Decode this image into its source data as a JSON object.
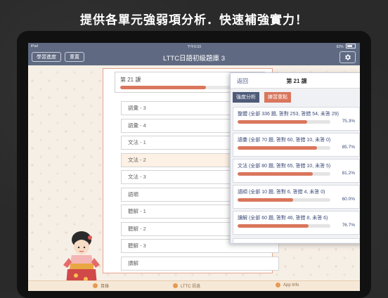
{
  "headline": "提供各單元強弱項分析．快速補強實力！",
  "statusbar": {
    "left": "iPad",
    "time": "下午6:33",
    "battery": "82%"
  },
  "nav": {
    "progress_btn": "學習進度",
    "reset_btn": "重置",
    "title": "LTTC日語初級題庫 3",
    "gear_icon": "gear-icon"
  },
  "lesson": {
    "label": "第 21 課",
    "progress": 0.75,
    "sections": [
      {
        "label": "語彙 - 3"
      },
      {
        "label": "語彙 - 4"
      },
      {
        "label": "文法 - 1"
      },
      {
        "label": "文法 - 2",
        "active": true
      },
      {
        "label": "文法 - 3"
      },
      {
        "label": "語順"
      },
      {
        "label": "聽解 - 1"
      },
      {
        "label": "聽解 - 2"
      },
      {
        "label": "聽解 - 3"
      },
      {
        "label": "讀解"
      }
    ]
  },
  "stats": {
    "back": "返回",
    "title": "第 21 課",
    "tab_strength": "強度分析",
    "tab_practice": "練習重點",
    "cards": [
      {
        "text": "整體 (全部 336 題, 答對 253, 答錯 54, 未答 29)",
        "pct": "75.3%",
        "value": 75.3
      },
      {
        "text": "語彙 (全部 70 題, 答對 60, 答錯 10, 未答 0)",
        "pct": "85.7%",
        "value": 85.7
      },
      {
        "text": "文法 (全部 80 題, 答對 65, 答錯 10, 未答 5)",
        "pct": "81.2%",
        "value": 81.2
      },
      {
        "text": "語順 (全部 10 題, 答對 6, 答錯 4, 未答 0)",
        "pct": "60.0%",
        "value": 60.0
      },
      {
        "text": "讀解 (全部 60 題, 答對 46, 答錯 8, 未答 6)",
        "pct": "76.7%",
        "value": 76.7
      }
    ]
  },
  "tabbar": {
    "items": [
      {
        "label": "目錄",
        "icon": "book-icon"
      },
      {
        "label": "LTTC 訊息",
        "icon": "info-icon"
      },
      {
        "label": "App Info",
        "icon": "app-info-icon"
      }
    ]
  },
  "colors": {
    "accent": "#d9765c",
    "nav": "#5f6a82",
    "text_blue": "#3a4a78"
  }
}
